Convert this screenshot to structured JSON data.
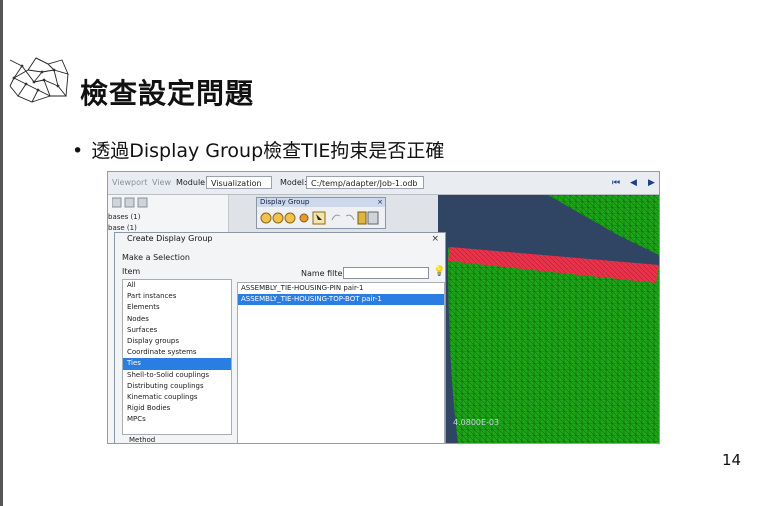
{
  "slide": {
    "title": "檢查設定問題",
    "bullet": "透過Display Group檢查TIE拘束是否正確",
    "bullet_marker": "•",
    "page_number": "14"
  },
  "app": {
    "menu_items": [
      "Viewport",
      "View"
    ],
    "module_label": "Module:",
    "module_value": "Visualization",
    "model_label": "Model:",
    "model_value": "C:/temp/adapter/Job-1.odb",
    "nav_buttons": [
      "⏮",
      "◀",
      "▶"
    ],
    "left_panel_items": [
      "bases (1)",
      "base (1)"
    ],
    "viewport_readout": "4.0800E-03"
  },
  "display_group_toolbar": {
    "title": "Display Group",
    "close": "×",
    "icons": [
      "display-group-icon-1",
      "display-group-icon-2",
      "display-group-icon-3",
      "arrow-icon",
      "undo-icon",
      "redo-icon",
      "dg-manager-icon",
      "dg-table-icon"
    ]
  },
  "create_display_group": {
    "title": "Create Display Group",
    "close": "×",
    "make_selection": "Make a Selection",
    "item_header": "Item",
    "items": [
      "All",
      "Part instances",
      "Elements",
      "Nodes",
      "Surfaces",
      "Display groups",
      "Coordinate systems",
      "Ties",
      "Shell-to-Solid couplings",
      "Distributing couplings",
      "Kinematic couplings",
      "Rigid Bodies",
      "MPCs"
    ],
    "selected_item": "Ties",
    "method_label": "Method",
    "name_filter_label": "Name filter:",
    "name_filter_value": "",
    "results": [
      "ASSEMBLY_TIE-HOUSING-PIN pair-1",
      "ASSEMBLY_TIE-HOUSING-TOP-BOT pair-1"
    ],
    "selected_result": "ASSEMBLY_TIE-HOUSING-TOP-BOT pair-1"
  },
  "colors": {
    "mesh_green": "#1fa31a",
    "tie_red": "#e8324a",
    "selection_blue": "#2a7de1",
    "viewport_bg": "#2f4563"
  }
}
